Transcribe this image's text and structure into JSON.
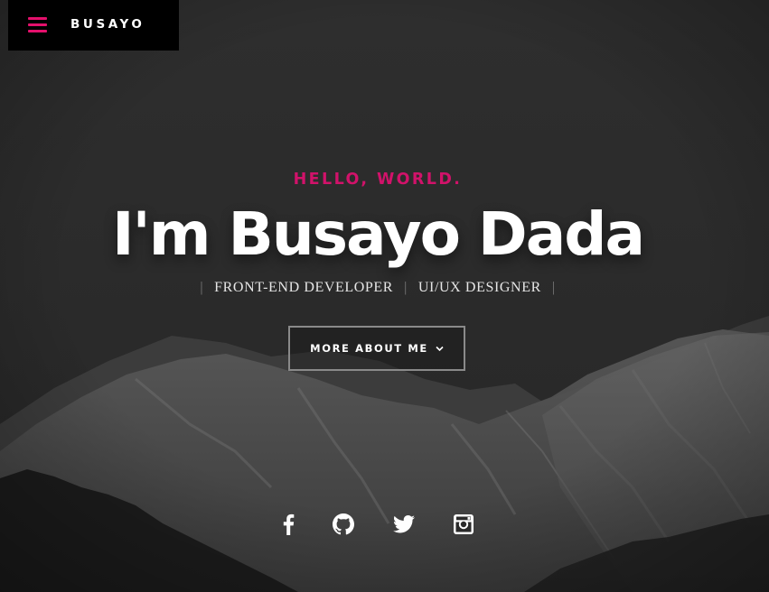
{
  "header": {
    "logo": "BUSAYO",
    "menu_icon": "hamburger-menu-icon",
    "accent_color": "#e5106c"
  },
  "intro": {
    "greeting": "HELLO, WORLD.",
    "name": "I'm Busayo Dada",
    "positions": [
      "FRONT-END DEVELOPER",
      "UI/UX DESIGNER"
    ],
    "separator": "|",
    "more_button": {
      "label": "MORE ABOUT ME",
      "icon": "chevron-down-icon"
    }
  },
  "social": {
    "items": [
      {
        "name": "facebook",
        "icon": "facebook-icon"
      },
      {
        "name": "github",
        "icon": "github-icon"
      },
      {
        "name": "twitter",
        "icon": "twitter-icon"
      },
      {
        "name": "instagram",
        "icon": "instagram-icon"
      }
    ]
  }
}
